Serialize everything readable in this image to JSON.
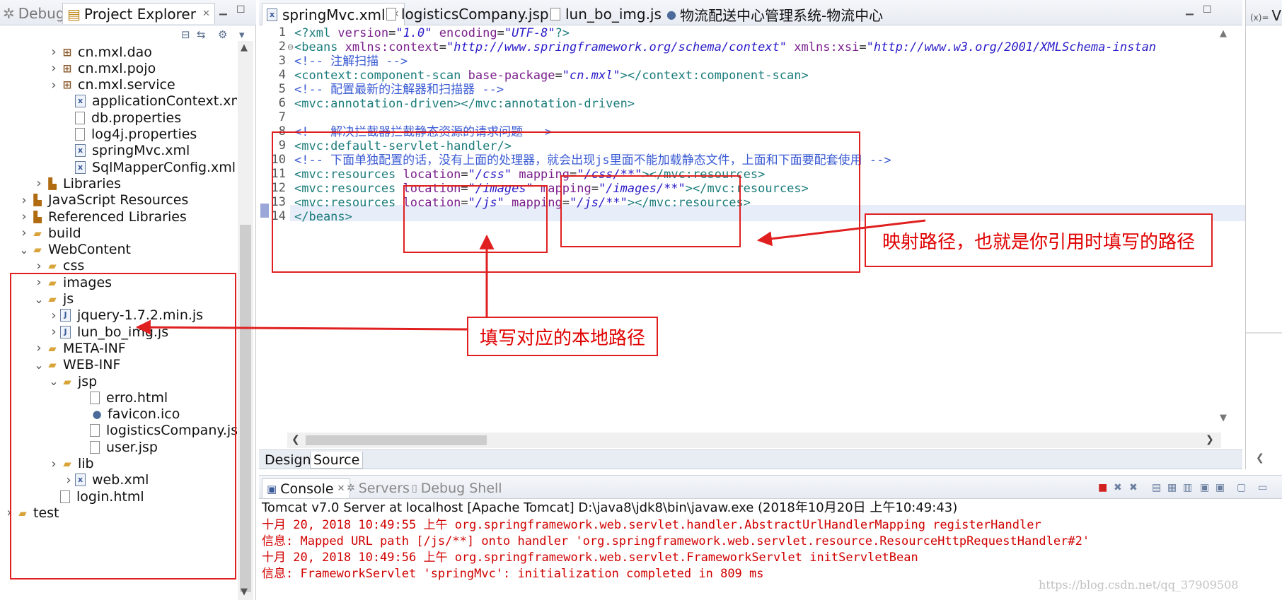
{
  "left_tabs": {
    "debug": "Debug",
    "project_explorer": "Project Explorer"
  },
  "tree": [
    {
      "label": "cn.mxl.dao",
      "icon": "package-icon",
      "expandable": true
    },
    {
      "label": "cn.mxl.pojo",
      "icon": "package-icon",
      "expandable": true
    },
    {
      "label": "cn.mxl.service",
      "icon": "package-icon",
      "expandable": true
    },
    {
      "label": "applicationContext.xml",
      "icon": "xml-file-icon",
      "expandable": false
    },
    {
      "label": "db.properties",
      "icon": "file-icon",
      "expandable": false
    },
    {
      "label": "log4j.properties",
      "icon": "file-icon",
      "expandable": false
    },
    {
      "label": "springMvc.xml",
      "icon": "xml-file-icon",
      "expandable": false
    },
    {
      "label": "SqlMapperConfig.xml",
      "icon": "xml-file-icon",
      "expandable": false
    },
    {
      "label": "Libraries",
      "icon": "library-icon",
      "expandable": true
    },
    {
      "label": "JavaScript Resources",
      "icon": "library-icon",
      "expandable": true
    },
    {
      "label": "Referenced Libraries",
      "icon": "library-icon",
      "expandable": true
    },
    {
      "label": "build",
      "icon": "folder-icon",
      "expandable": true
    },
    {
      "label": "WebContent",
      "icon": "folder-icon",
      "expandable": true,
      "expanded": true
    },
    {
      "label": "css",
      "icon": "folder-icon",
      "expandable": true
    },
    {
      "label": "images",
      "icon": "folder-icon",
      "expandable": true
    },
    {
      "label": "js",
      "icon": "folder-icon",
      "expandable": true,
      "expanded": true
    },
    {
      "label": "jquery-1.7.2.min.js",
      "icon": "js-file-icon",
      "expandable": true
    },
    {
      "label": "lun_bo_img.js",
      "icon": "js-file-icon",
      "expandable": true
    },
    {
      "label": "META-INF",
      "icon": "folder-icon",
      "expandable": true
    },
    {
      "label": "WEB-INF",
      "icon": "folder-icon",
      "expandable": true,
      "expanded": true
    },
    {
      "label": "jsp",
      "icon": "folder-icon",
      "expandable": true,
      "expanded": true
    },
    {
      "label": "erro.html",
      "icon": "file-icon",
      "expandable": false
    },
    {
      "label": "favicon.ico",
      "icon": "globe-icon",
      "expandable": false
    },
    {
      "label": "logisticsCompany.jsp",
      "icon": "file-icon",
      "expandable": false
    },
    {
      "label": "user.jsp",
      "icon": "file-icon",
      "expandable": false
    },
    {
      "label": "lib",
      "icon": "folder-icon",
      "expandable": true
    },
    {
      "label": "web.xml",
      "icon": "xml-file-icon",
      "expandable": true
    },
    {
      "label": "login.html",
      "icon": "file-icon",
      "expandable": false
    },
    {
      "label": "test",
      "icon": "project-icon",
      "expandable": true
    }
  ],
  "editor_tabs": [
    {
      "label": "springMvc.xml",
      "active": true
    },
    {
      "label": "logisticsCompany.jsp",
      "active": false
    },
    {
      "label": "lun_bo_img.js",
      "active": false
    },
    {
      "label": "物流配送中心管理系统-物流中心",
      "active": false
    }
  ],
  "line_numbers": [
    "1",
    "2",
    "3",
    "4",
    "5",
    "6",
    "7",
    "8",
    "9",
    "10",
    "11",
    "12",
    "13",
    "14"
  ],
  "code": {
    "l1": {
      "a": "<?xml ",
      "b": "version",
      "c": "=",
      "d": "\"1.0\"",
      "e": " ",
      "f": "encoding",
      "g": "=",
      "h": "\"UTF-8\"",
      "i": "?>"
    },
    "l2": {
      "a": "<beans ",
      "b": "xmlns:context",
      "c": "=",
      "d": "\"http://www.springframework.org/schema/context\"",
      "e": " ",
      "f": "xmlns:xsi",
      "g": "=",
      "h": "\"http://www.w3.org/2001/XMLSchema-instan"
    },
    "l3": "<!-- 注解扫描 -->",
    "l4": {
      "a": "<context:component-scan ",
      "b": "base-package",
      "c": "=",
      "d": "\"cn.mxl\"",
      "e": "></context:component-scan>"
    },
    "l5": "<!-- 配置最新的注解器和扫描器 -->",
    "l6": "<mvc:annotation-driven></mvc:annotation-driven>",
    "l8": "<!-- 解决拦截器拦截静态资源的请求问题 -->",
    "l9": "<mvc:default-servlet-handler/>",
    "l10": "<!-- 下面单独配置的话，没有上面的处理器，就会出现js里面不能加载静态文件，上面和下面要配套使用 -->",
    "l11": {
      "a": "<mvc:resources ",
      "b": "location",
      "c": "=",
      "d": "\"/css\"",
      "e": " ",
      "f": "mapping",
      "g": "=",
      "h": "\"/css/**\"",
      "i": "></mvc:resources>"
    },
    "l12": {
      "a": "<mvc:resources ",
      "b": "location",
      "c": "=",
      "d": "\"/images\"",
      "e": " ",
      "f": "mapping",
      "g": "=",
      "h": "\"/images/**\"",
      "i": "></mvc:resources>"
    },
    "l13": {
      "a": "<mvc:resources ",
      "b": "location",
      "c": "=",
      "d": "\"/js\"",
      "e": " ",
      "f": "mapping",
      "g": "=",
      "h": "\"/js/**\"",
      "i": "></mvc:resources>"
    },
    "l14": "</beans>"
  },
  "design_source": {
    "design": "Design",
    "source": "Source"
  },
  "right_pane": {
    "label": "(x)=",
    "title": "V"
  },
  "console_tabs": {
    "console": "Console",
    "servers": "Servers",
    "debug_shell": "Debug Shell"
  },
  "console": {
    "header": "Tomcat v7.0 Server at localhost [Apache Tomcat] D:\\java8\\jdk8\\bin\\javaw.exe (2018年10月20日 上午10:49:43)",
    "lines": [
      "十月 20, 2018 10:49:55 上午 org.springframework.web.servlet.handler.AbstractUrlHandlerMapping registerHandler",
      "信息: Mapped URL path [/js/**] onto handler 'org.springframework.web.servlet.resource.ResourceHttpRequestHandler#2'",
      "十月 20, 2018 10:49:56 上午 org.springframework.web.servlet.FrameworkServlet initServletBean",
      "信息: FrameworkServlet 'springMvc': initialization completed in 809 ms"
    ]
  },
  "annotations": {
    "mapping_note": "映射路径，也就是你引用时填写的路径",
    "location_note": "填写对应的本地路径",
    "color": "#e02020"
  },
  "watermark": "https://blog.csdn.net/qq_37909508",
  "colors": {
    "tag": "#1c7c7c",
    "attribute": "#7a1f8c",
    "string": "#2a1cc8",
    "comment": "#3a5bd3",
    "console_error": "#d10000"
  }
}
